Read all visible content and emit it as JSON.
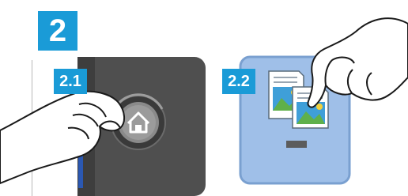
{
  "step": {
    "number": "2"
  },
  "substeps": [
    {
      "label": "2.1",
      "icon": "home-icon",
      "accent": "#1a9bd7"
    },
    {
      "label": "2.2",
      "icon": "document-pages-icon",
      "accent": "#1a9bd7"
    }
  ],
  "colors": {
    "badge": "#1a9bd7",
    "device_panel": "#4f4f4f",
    "screen": "#9fbfe8",
    "screen_border": "#7aa0d0"
  }
}
